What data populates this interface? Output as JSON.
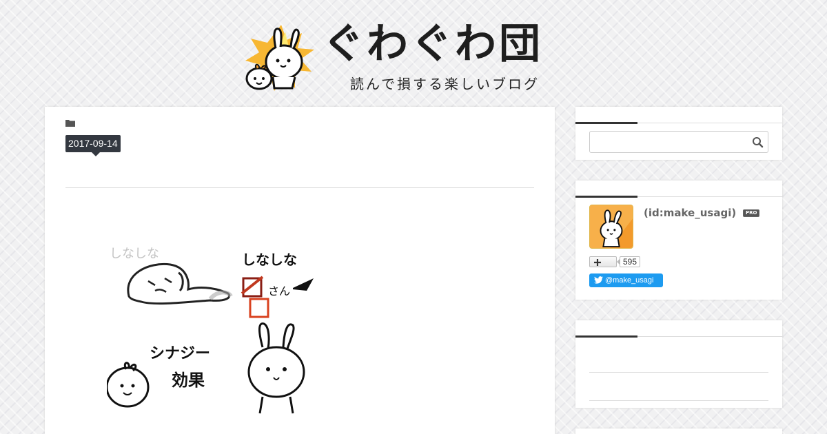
{
  "header": {
    "title": "ぐわぐわ団",
    "tagline": "読んで損する楽しいブログ",
    "mascot_icon": "rabbit-mascot-icon"
  },
  "article": {
    "category_icon": "folder-icon",
    "date": "2017-09-14",
    "image": {
      "texts": {
        "top_left": "しなしな",
        "top_right": "しなしな",
        "subject": "さん",
        "bottom_left": "シナジー",
        "bottom_left_2": "効果"
      }
    }
  },
  "sidebar": {
    "search": {
      "placeholder": "",
      "icon": "search-icon"
    },
    "profile": {
      "id_text": "(id:make_usagi)",
      "pro_label": "PRO",
      "follow_icon": "plus-icon",
      "follower_count": "595",
      "twitter_handle": "@make_usagi",
      "twitter_icon": "twitter-bird-icon"
    }
  },
  "colors": {
    "background": "#f1f1f2",
    "card": "#ffffff",
    "date_badge": "#333840",
    "twitter": "#1d9bf0",
    "accent": "#333333"
  }
}
